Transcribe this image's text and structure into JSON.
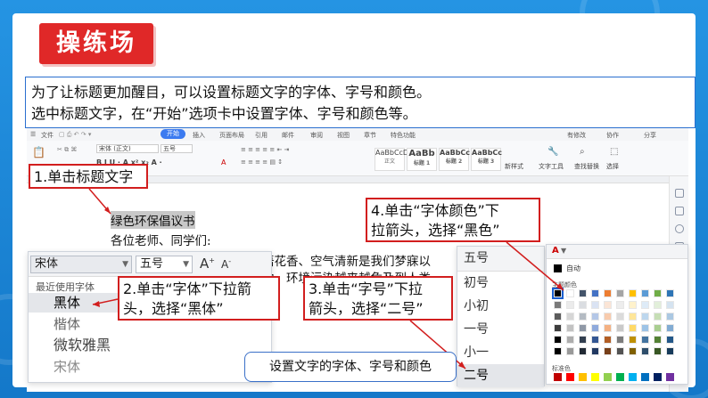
{
  "slide": {
    "title": "操练场",
    "intro_line1": "为了让标题更加醒目，可以设置标题文字的字体、字号和颜色。",
    "intro_line2": "选中标题文字，在“开始”选项卡中设置字体、字号和颜色等。",
    "caption": "设置文字的字体、字号和颜色"
  },
  "wps": {
    "menu_file": "文件",
    "tabs": [
      "开始",
      "插入",
      "页面布局",
      "引用",
      "邮件",
      "审阅",
      "视图",
      "章节",
      "特色功能"
    ],
    "active_tab": "开始",
    "right_items": [
      "有修改",
      "协作",
      "分享"
    ],
    "ribbon": {
      "font_name": "宋体 (正文)",
      "font_size": "五号",
      "styles": [
        {
          "sample": "AaBbCcDd",
          "label": "正文"
        },
        {
          "sample": "AaBb",
          "label": "标题 1"
        },
        {
          "sample": "AaBbCc",
          "label": "标题 2"
        },
        {
          "sample": "AaBbCc",
          "label": "标题 3"
        }
      ],
      "new_style": "新样式",
      "text_tools": "文字工具",
      "find_replace": "查找替换",
      "select": "选择"
    },
    "document": {
      "heading": "绿色环保倡议书",
      "greeting": "各位老师、同学们:",
      "line1": "明媚、鸟语花香、空气清新是我们梦寐以",
      "line2": "屋侵蚀了她，环境污染越来越危及到人类"
    }
  },
  "callouts": {
    "c1": "1.单击标题文字",
    "c2_line1": "2.单击“字体”下拉箭",
    "c2_line2": "头，选择“黑体”",
    "c3_line1": "3.单击“字号”下拉",
    "c3_line2": "箭头，选择“二号”",
    "c4_line1": "4.单击“字体颜色”下",
    "c4_line2": "拉箭头，选择“黑色”"
  },
  "font_panel": {
    "font_value": "宋体",
    "size_value": "五号",
    "grow_label": "A+",
    "shrink_label": "A-",
    "section_header": "最近使用字体",
    "fonts": [
      "黑体",
      "楷体",
      "微软雅黑",
      "宋体"
    ],
    "selected_font": "黑体"
  },
  "size_panel": {
    "header_value": "五号",
    "sizes": [
      "初号",
      "小初",
      "一号",
      "小一",
      "二号"
    ],
    "selected_size": "二号"
  },
  "color_panel": {
    "auto_label": "自动",
    "theme_label": "主题颜色",
    "standard_label": "标准色",
    "theme_top_row": [
      "#000000",
      "#ffffff",
      "#44546a",
      "#4472c4",
      "#ed7d31",
      "#a5a5a5",
      "#ffc000",
      "#5b9bd5",
      "#70ad47",
      "#2e75b6"
    ],
    "standard_colors": [
      "#c00000",
      "#ff0000",
      "#ffc000",
      "#ffff00",
      "#92d050",
      "#00b050",
      "#00b0f0",
      "#0070c0",
      "#002060",
      "#7030a0"
    ],
    "selected_color": "#000000",
    "accent_red": "#e02828",
    "accent_blue": "#2a6fcf"
  }
}
